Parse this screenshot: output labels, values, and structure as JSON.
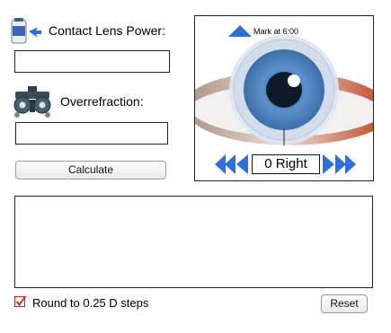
{
  "contact_lens": {
    "label": "Contact Lens Power:",
    "icon": "contact-lens-bottle-icon",
    "value": "",
    "placeholder": ""
  },
  "overrefraction": {
    "label": "Overrefraction:",
    "icon": "phoropter-icon",
    "value": "",
    "placeholder": ""
  },
  "calculate_label": "Calculate",
  "eye_panel": {
    "mark_label": "Mark at 6:00",
    "axis_readout": "0 Right",
    "icons": {
      "mark": "triangle-up-icon",
      "rotate_fast_left": "double-arrow-left-icon",
      "rotate_left": "arrow-left-icon",
      "rotate_right": "arrow-right-icon",
      "rotate_fast_right": "double-arrow-right-icon"
    },
    "colors": {
      "arrow_blue": "#2f6fd8",
      "iris_blue": "#4a86c8"
    }
  },
  "result_text": "",
  "round_option": {
    "label": "Round to 0.25 D steps",
    "checked": true,
    "check_color": "#cc2222"
  },
  "reset_label": "Reset"
}
